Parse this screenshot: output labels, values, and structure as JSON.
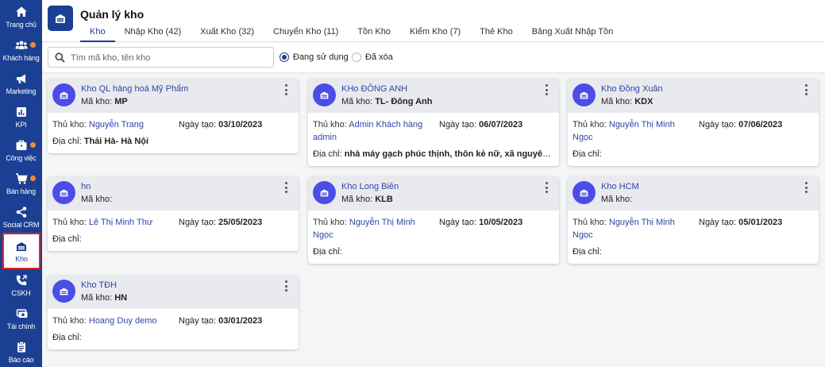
{
  "sidebar": {
    "items": [
      {
        "label": "Trang chủ",
        "icon": "home-icon",
        "dot": false
      },
      {
        "label": "Khách hàng",
        "icon": "users-icon",
        "dot": true
      },
      {
        "label": "Marketing",
        "icon": "megaphone-icon",
        "dot": false
      },
      {
        "label": "KPI",
        "icon": "chart-icon",
        "dot": false
      },
      {
        "label": "Công việc",
        "icon": "briefcase-icon",
        "dot": true
      },
      {
        "label": "Bán hàng",
        "icon": "cart-icon",
        "dot": true
      },
      {
        "label": "Social CRM",
        "icon": "share-icon",
        "dot": false
      },
      {
        "label": "Kho",
        "icon": "warehouse-icon",
        "dot": false,
        "active": true
      },
      {
        "label": "CSKH",
        "icon": "phone-icon",
        "dot": false
      },
      {
        "label": "Tài chính",
        "icon": "money-icon",
        "dot": false
      },
      {
        "label": "Báo cáo",
        "icon": "clipboard-icon",
        "dot": false
      }
    ]
  },
  "header": {
    "title": "Quản lý kho",
    "tabs": [
      {
        "label": "Kho",
        "active": true
      },
      {
        "label": "Nhập Kho (42)"
      },
      {
        "label": "Xuất Kho (32)"
      },
      {
        "label": "Chuyển Kho (11)"
      },
      {
        "label": "Tồn Kho"
      },
      {
        "label": "Kiểm Kho (7)"
      },
      {
        "label": "Thẻ Kho"
      },
      {
        "label": "Bảng Xuất Nhập Tồn"
      }
    ]
  },
  "toolbar": {
    "search_placeholder": "Tìm mã kho, tên kho",
    "filter_active": "Đang sử dụng",
    "filter_deleted": "Đã xóa"
  },
  "labels": {
    "code": "Mã kho:",
    "keeper": "Thủ kho:",
    "created": "Ngày tạo:",
    "address": "Địa chỉ:"
  },
  "warehouses": [
    {
      "name": "Kho QL hàng hoá Mỹ Phẩm",
      "code": "MP",
      "keeper": "Nguyễn Trang",
      "created": "03/10/2023",
      "address": "Thái Hà- Hà Nội"
    },
    {
      "name": "KHo ĐÔNG ANH",
      "code": "TL- Đông Anh",
      "keeper": "Admin Khách hàng admin",
      "created": "06/07/2023",
      "address": "nhà máy gạch phúc thịnh, thôn kẻ nữ, xã nguyên khê, huyện Đông Anh"
    },
    {
      "name": "Kho Đồng Xuân",
      "code": "KDX",
      "keeper": "Nguyễn Thị Minh Ngọc",
      "created": "07/06/2023",
      "address": ""
    },
    {
      "name": "hn",
      "code": "",
      "keeper": "Lê Thị Minh Thư",
      "created": "25/05/2023",
      "address": ""
    },
    {
      "name": "Kho Long Biên",
      "code": "KLB",
      "keeper": "Nguyễn Thị Minh Ngọc",
      "created": "10/05/2023",
      "address": ""
    },
    {
      "name": "Kho HCM",
      "code": "",
      "keeper": "Nguyễn Thị Minh Ngọc",
      "created": "05/01/2023",
      "address": ""
    },
    {
      "name": "Kho TĐH",
      "code": "HN",
      "keeper": "Hoang Duy demo",
      "created": "03/01/2023",
      "address": ""
    }
  ]
}
